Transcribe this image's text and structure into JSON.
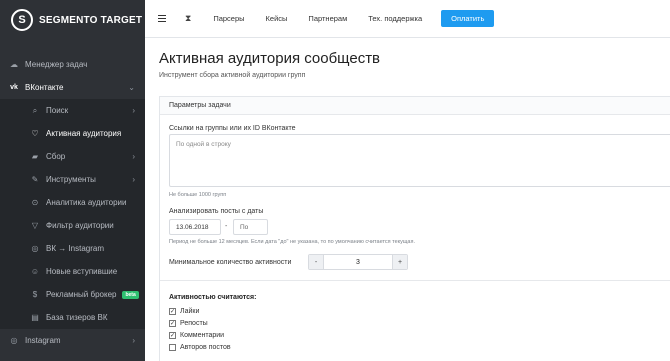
{
  "app": {
    "logo_letter": "S",
    "logo_text": "SEGMENTO TARGET"
  },
  "sidebar": {
    "items": [
      {
        "label": "Менеджер задач",
        "icon": "cloud-icon",
        "glyph": "☁"
      },
      {
        "label": "ВКонтакте",
        "icon": "vk-icon",
        "glyph": "vk"
      },
      {
        "label": "Поиск",
        "icon": "search-icon",
        "glyph": "⌕"
      },
      {
        "label": "Активная аудитория",
        "icon": "heart-icon",
        "glyph": "♡"
      },
      {
        "label": "Сбор",
        "icon": "folder-icon",
        "glyph": "▰"
      },
      {
        "label": "Инструменты",
        "icon": "wrench-icon",
        "glyph": "✎"
      },
      {
        "label": "Аналитика аудитории",
        "icon": "analytics-icon",
        "glyph": "⊙"
      },
      {
        "label": "Фильтр аудитории",
        "icon": "filter-icon",
        "glyph": "▽"
      },
      {
        "label": "ВК → Instagram",
        "icon": "instagram-icon",
        "glyph": "◎"
      },
      {
        "label": "Новые вступившие",
        "icon": "users-icon",
        "glyph": "☺"
      },
      {
        "label": "Рекламный брокер",
        "icon": "dollar-icon",
        "glyph": "$",
        "badge": "beta"
      },
      {
        "label": "База тизеров ВК",
        "icon": "database-icon",
        "glyph": "▤"
      },
      {
        "label": "Instagram",
        "icon": "instagram-icon",
        "glyph": "◎"
      }
    ]
  },
  "topbar": {
    "links": [
      "Парсеры",
      "Кейсы",
      "Партнерам",
      "Тех. поддержка"
    ],
    "pay_label": "Оплатить"
  },
  "page": {
    "title": "Активная аудитория сообществ",
    "subtitle": "Инструмент сбора активной аудитории групп"
  },
  "form": {
    "section_title": "Параметры задачи",
    "links_label": "Ссылки на группы или их ID ВКонтакте",
    "links_placeholder": "По одной в строку",
    "links_hint": "Не больше 1000 групп",
    "dates_label": "Анализировать посты с даты",
    "date_from": "13.06.2018",
    "date_dash": "-",
    "date_to_placeholder": "По",
    "dates_hint": "Период не больше 12 месяцев. Если дата \"до\" не указана, то по умолчанию считается текущая.",
    "min_activity_label": "Минимальное количество активности",
    "min_activity_value": "3",
    "minus": "-",
    "plus": "+",
    "activity_title": "Активностью считаются:",
    "checkboxes": [
      {
        "label": "Лайки",
        "checked": true
      },
      {
        "label": "Репосты",
        "checked": true
      },
      {
        "label": "Комментарии",
        "checked": true
      },
      {
        "label": "Авторов постов",
        "checked": false
      }
    ]
  }
}
